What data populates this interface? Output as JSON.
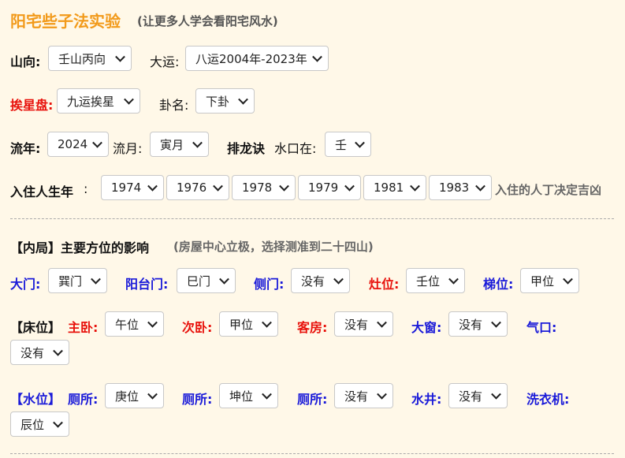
{
  "header": {
    "title": "阳宅些子法实验",
    "subtitle": "(让更多人学会看阳宅风水)"
  },
  "row1": {
    "shan_label": "山向:",
    "shan_value": "壬山丙向",
    "dayun_label": "大运:",
    "dayun_value": "八运2004年-2023年"
  },
  "row2": {
    "aixing_label": "挨星盘:",
    "aixing_value": "九运挨星",
    "gua_label": "卦名:",
    "gua_value": "下卦"
  },
  "row3": {
    "liunian_label": "流年:",
    "liunian_value": "2024",
    "liuyue_label": "流月:",
    "liuyue_value": "寅月",
    "pailong_label": "排龙诀",
    "shuikou_label": "水口在:",
    "shuikou_value": "壬"
  },
  "row4": {
    "label": "入住人生年",
    "colon": ":",
    "years": [
      "1974",
      "1976",
      "1978",
      "1979",
      "1981",
      "1983"
    ],
    "note": "入住的人丁决定吉凶"
  },
  "neiju": {
    "title": "【内局】主要方位的影响",
    "subtitle": "(房屋中心立极，选择测准到二十四山)",
    "damen_label": "大门:",
    "damen_value": "巽门",
    "yangtai_label": "阳台门:",
    "yangtai_value": "巳门",
    "cemen_label": "侧门:",
    "cemen_value": "没有",
    "zaowei_label": "灶位:",
    "zaowei_value": "壬位",
    "tiwei_label": "梯位:",
    "tiwei_value": "甲位"
  },
  "chuangwei": {
    "prefix": "【床位】",
    "zhuwo_label": "主卧:",
    "zhuwo_value": "午位",
    "ciwo_label": "次卧:",
    "ciwo_value": "甲位",
    "kefang_label": "客房:",
    "kefang_value": "没有",
    "dachuang_label": "大窗:",
    "dachuang_value": "没有",
    "qikou_label": "气口:",
    "qikou_value": "没有"
  },
  "shuiwei": {
    "prefix": "【水位】",
    "cesuo1_label": "厕所:",
    "cesuo1_value": "庚位",
    "cesuo2_label": "厕所:",
    "cesuo2_value": "坤位",
    "cesuo3_label": "厕所:",
    "cesuo3_value": "没有",
    "shuijing_label": "水井:",
    "shuijing_value": "没有",
    "xiyiji_label": "洗衣机:",
    "xiyiji_value": "辰位"
  },
  "colors": {
    "background": "#fff8e8",
    "title": "#f29a1a",
    "red_label": "#e8120c",
    "blue_label": "#1a1ad9"
  }
}
